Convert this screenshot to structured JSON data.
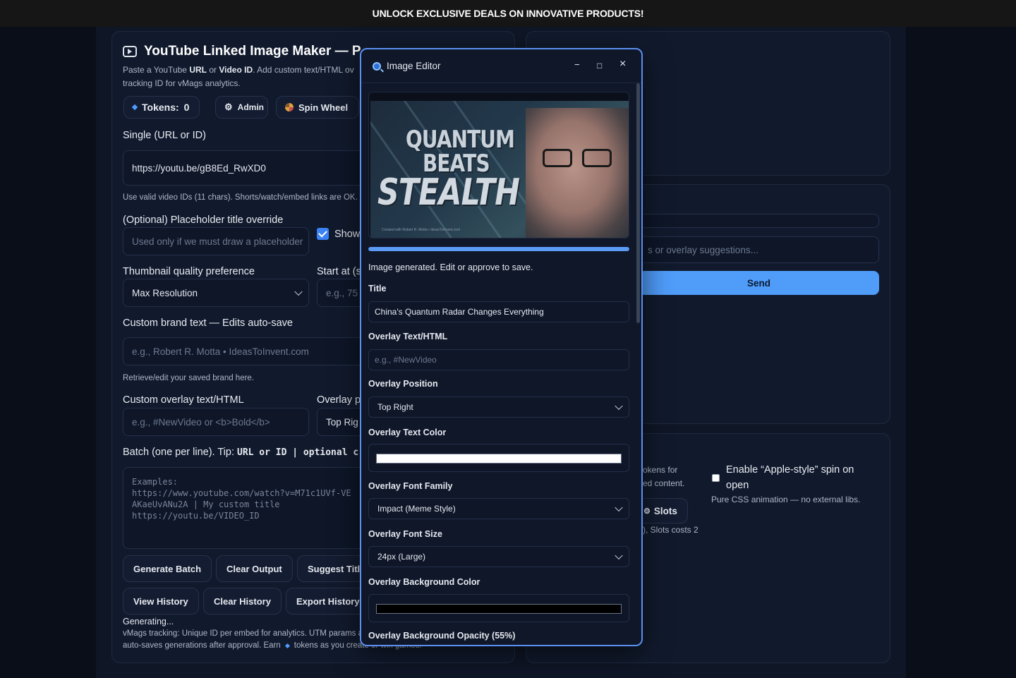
{
  "banner": {
    "text": "UNLOCK EXCLUSIVE DEALS ON INNOVATIVE PRODUCTS!"
  },
  "header": {
    "title": "YouTube Linked Image Maker — P",
    "desc_1": "Paste a YouTube ",
    "desc_url": "URL",
    "desc_2": " or ",
    "desc_vid": "Video ID",
    "desc_3": ". Add custom text/HTML ov",
    "desc_4": "tracking ID for vMags analytics."
  },
  "tokens": {
    "label": "Tokens:",
    "count": "0"
  },
  "admin_label": "Admin",
  "spin_label": "Spin Wheel",
  "single": {
    "label": "Single (URL or ID)",
    "value": "https://youtu.be/gB8Ed_RwXD0",
    "hint": "Use valid video IDs (11 chars). Shorts/watch/embed links are OK."
  },
  "placeholder_title": {
    "label": "(Optional) Placeholder title override",
    "placeholder": "Used only if we must draw a placeholder"
  },
  "show_label": "Show",
  "quality": {
    "label": "Thumbnail quality preference",
    "value": "Max Resolution"
  },
  "start_at": {
    "label": "Start at (s",
    "placeholder": "e.g., 75"
  },
  "brand": {
    "label": "Custom brand text — Edits auto-save",
    "placeholder": "e.g., Robert R. Motta • IdeasToInvent.com",
    "hint": "Retrieve/edit your saved brand here."
  },
  "overlay": {
    "label": "Custom overlay text/HTML",
    "placeholder": "e.g., #NewVideo or <b>Bold</b>",
    "pos_label": "Overlay p",
    "pos_value": "Top Rig"
  },
  "batch": {
    "label": "Batch (one per line). Tip: ",
    "code": "URL or ID | optional c",
    "placeholder": "Examples:\nhttps://www.youtube.com/watch?v=M71c1UVf-VE\nAKaeUvANu2A | My custom title\nhttps://youtu.be/VIDEO_ID"
  },
  "buttons": {
    "generate_batch": "Generate Batch",
    "clear_output": "Clear Output",
    "suggest_title": "Suggest Titl",
    "view_history": "View History",
    "clear_history": "Clear History",
    "export_history": "Export History"
  },
  "status": "Generating...",
  "footer": {
    "line1": "vMags tracking: Unique ID per embed for analytics. UTM params a",
    "line2a": "auto-saves generations after approval. Earn",
    "line2b": "tokens as you create or win games."
  },
  "right": {
    "chat_placeholder": "s or overlay suggestions...",
    "send": "Send",
    "tokens_frag_1": "okens for",
    "tokens_frag_2": "ed content.",
    "slots_label": "Slots",
    "slots_cost": "), Slots costs 2",
    "apple_spin_1": "Enable “Apple-style” spin on",
    "apple_spin_2": "open",
    "apple_hint": "Pure CSS animation — no external libs."
  },
  "modal": {
    "title": "Image Editor",
    "min": "−",
    "max": "□",
    "close": "×",
    "thumb_line1": "QUANTUM",
    "thumb_line2": "BEATS",
    "thumb_line3": "STEALTH",
    "thumb_footer": "Created with Robert R. Motta • IdeasToInvent.com",
    "progress_pct": 100,
    "status": "Image generated. Edit or approve to save.",
    "title_label": "Title",
    "title_value": "China's Quantum Radar Changes Everything",
    "overlay_text_label": "Overlay Text/HTML",
    "overlay_text_placeholder": "e.g., #NewVideo",
    "overlay_pos_label": "Overlay Position",
    "overlay_pos_value": "Top Right",
    "overlay_color_label": "Overlay Text Color",
    "overlay_color": "#ffffff",
    "font_family_label": "Overlay Font Family",
    "font_family_value": "Impact (Meme Style)",
    "font_size_label": "Overlay Font Size",
    "font_size_value": "24px (Large)",
    "bg_color_label": "Overlay Background Color",
    "bg_color": "#000000",
    "bg_opacity_label": "Overlay Background Opacity (55%)"
  },
  "colors": {
    "accent": "#5b8ff0",
    "send": "#4f9cf9",
    "panel": "#111a2d",
    "page": "#0a0e18"
  }
}
